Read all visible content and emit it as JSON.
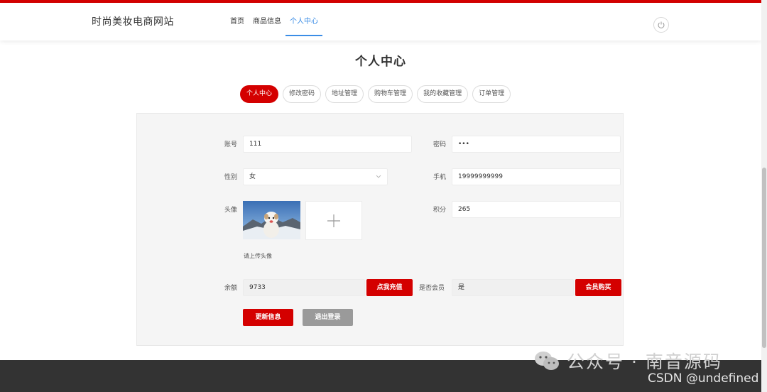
{
  "header": {
    "brand": "时尚美妆电商网站",
    "nav": [
      "首页",
      "商品信息",
      "个人中心"
    ],
    "active_nav": 2
  },
  "page": {
    "title": "个人中心"
  },
  "tabs": [
    "个人中心",
    "修改密码",
    "地址管理",
    "购物车管理",
    "我的收藏管理",
    "订单管理"
  ],
  "active_tab": 0,
  "form": {
    "account_label": "账号",
    "account_value": "111",
    "password_label": "密码",
    "password_value": "•••",
    "gender_label": "性别",
    "gender_value": "女",
    "phone_label": "手机",
    "phone_value": "19999999999",
    "avatar_label": "头像",
    "avatar_hint": "请上传头像",
    "points_label": "积分",
    "points_value": "265",
    "balance_label": "余额",
    "balance_value": "9733",
    "recharge_button": "点我充值",
    "member_label": "是否会员",
    "member_value": "是",
    "buy_member_button": "会员购买",
    "update_button": "更新信息",
    "logout_button": "退出登录"
  },
  "watermark": {
    "line1": "公众号 · 南音源码",
    "line2": "CSDN @undefined"
  },
  "colors": {
    "accent": "#d40000",
    "nav_active": "#3b8de6",
    "footer": "#333333"
  }
}
